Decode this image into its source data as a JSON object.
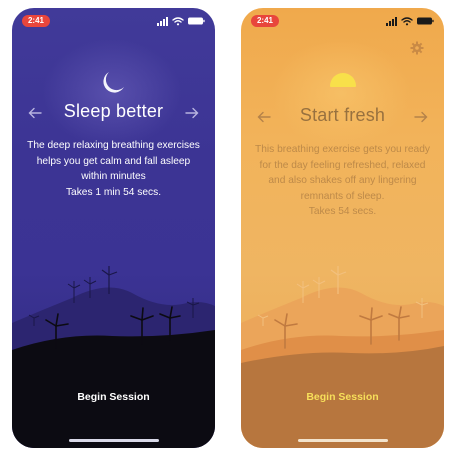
{
  "screens": [
    {
      "id": "sleep",
      "time": "2:41",
      "icon": "moon-icon",
      "title": "Sleep better",
      "description": "The deep relaxing breathing exercises helps you get calm and fall asleep within minutes",
      "duration": "Takes 1 min 54 secs.",
      "button_label": "Begin Session",
      "colors": {
        "background": "#3c3494",
        "hill": "#2c2570",
        "ground": "#0c0b12",
        "windmill": "#0c0b12",
        "button": "#ffffff"
      }
    },
    {
      "id": "fresh",
      "time": "2:41",
      "icon": "sun-icon",
      "settings_icon": "gear-icon",
      "title": "Start fresh",
      "description": "This breathing exercise gets you ready for the day feeling refreshed, relaxed and also shakes off any lingering remnants of sleep.",
      "duration": "Takes 54 secs.",
      "button_label": "Begin Session",
      "colors": {
        "background": "#f0ad55",
        "hill": "#e8974a",
        "ground": "#b7763e",
        "windmill": "#c07a40",
        "button": "#f7df5a"
      }
    }
  ]
}
